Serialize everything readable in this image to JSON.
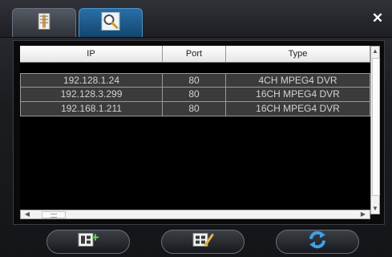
{
  "tabs": [
    {
      "icon": "device-list-icon"
    },
    {
      "icon": "search-icon"
    }
  ],
  "close_icon": "close-icon",
  "table": {
    "headers": [
      "IP",
      "Port",
      "Type"
    ],
    "rows": [
      {
        "ip": "192.128.1.24",
        "port": "80",
        "type": "4CH MPEG4 DVR"
      },
      {
        "ip": "192.128.3.299",
        "port": "80",
        "type": "16CH MPEG4 DVR"
      },
      {
        "ip": "192.168.1.211",
        "port": "80",
        "type": "16CH MPEG4 DVR"
      }
    ]
  },
  "buttons": [
    {
      "icon": "add-device-icon"
    },
    {
      "icon": "edit-device-icon"
    },
    {
      "icon": "refresh-icon"
    }
  ],
  "colors": {
    "tab_active": "#1f5a8c",
    "row_bg": "#3b3b3b",
    "row_text": "#d2d2d2"
  }
}
